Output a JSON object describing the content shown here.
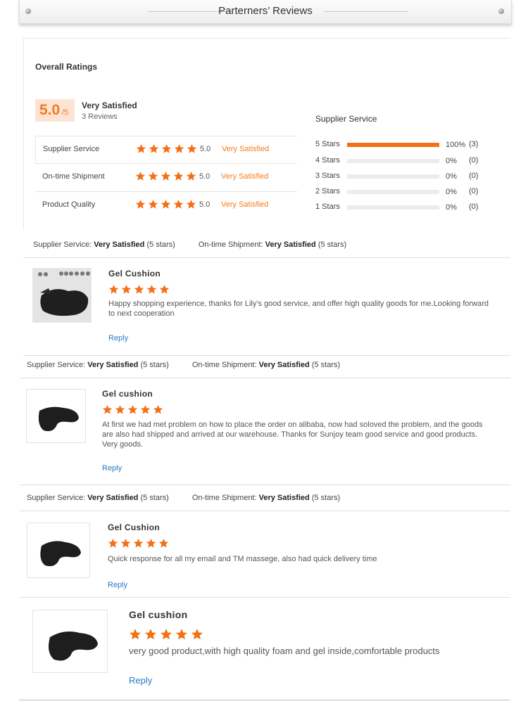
{
  "header": {
    "title": "Parterners’ Reviews"
  },
  "overall": {
    "title": "Overall Ratings",
    "score": "5.0",
    "score_of": "/5",
    "satisfaction": "Very Satisfied",
    "review_count": "3 Reviews",
    "rows": [
      {
        "label": "Supplier Service",
        "score": "5.0",
        "satisfaction": "Very Satisfied",
        "stars": 5
      },
      {
        "label": "On-time Shipment",
        "score": "5.0",
        "satisfaction": "Very Satisfied",
        "stars": 5
      },
      {
        "label": "Product Quality",
        "score": "5.0",
        "satisfaction": "Very Satisfied",
        "stars": 5
      }
    ]
  },
  "histogram": {
    "title": "Supplier Service",
    "rows": [
      {
        "label": "5 Stars",
        "percent": "100%",
        "count": "(3)",
        "fraction": 1.0
      },
      {
        "label": "4 Stars",
        "percent": "0%",
        "count": "(0)",
        "fraction": 0
      },
      {
        "label": "3 Stars",
        "percent": "0%",
        "count": "(0)",
        "fraction": 0
      },
      {
        "label": "2 Stars",
        "percent": "0%",
        "count": "(0)",
        "fraction": 0
      },
      {
        "label": "1 Stars",
        "percent": "0%",
        "count": "(0)",
        "fraction": 0
      }
    ]
  },
  "meta_labels": {
    "supplier": "Supplier Service:",
    "shipment": "On-time Shipment:",
    "value": "Very Satisfied",
    "stars": "(5 stars)"
  },
  "reviews": [
    {
      "product": "Gel Cushion",
      "stars": 5,
      "text": "Happy shopping experience, thanks for Lily's good service, and offer high quality goods for me.Looking forward to next cooperation",
      "reply": "Reply"
    },
    {
      "product": "Gel cushion",
      "stars": 5,
      "text": "At first we had met problem on how to place the order on alibaba, now had soloved the problem, and the goods are also had shipped and arrived at our warehouse. Thanks for Sunjoy team good service and good products. Very goods.",
      "reply": "Reply"
    },
    {
      "product": "Gel Cushion",
      "stars": 5,
      "text": "Quick response for all my email and TM massege, also had quick delivery time",
      "reply": "Reply"
    },
    {
      "product": "Gel cushion",
      "stars": 5,
      "text": "very good product,with high quality foam and gel inside,comfortable products",
      "reply": "Reply"
    }
  ],
  "colors": {
    "accent": "#f47a20",
    "star": "#f56f16",
    "link": "#2a7ac7"
  },
  "icons": {
    "star": "star-icon",
    "thumb": "cushion-image"
  }
}
